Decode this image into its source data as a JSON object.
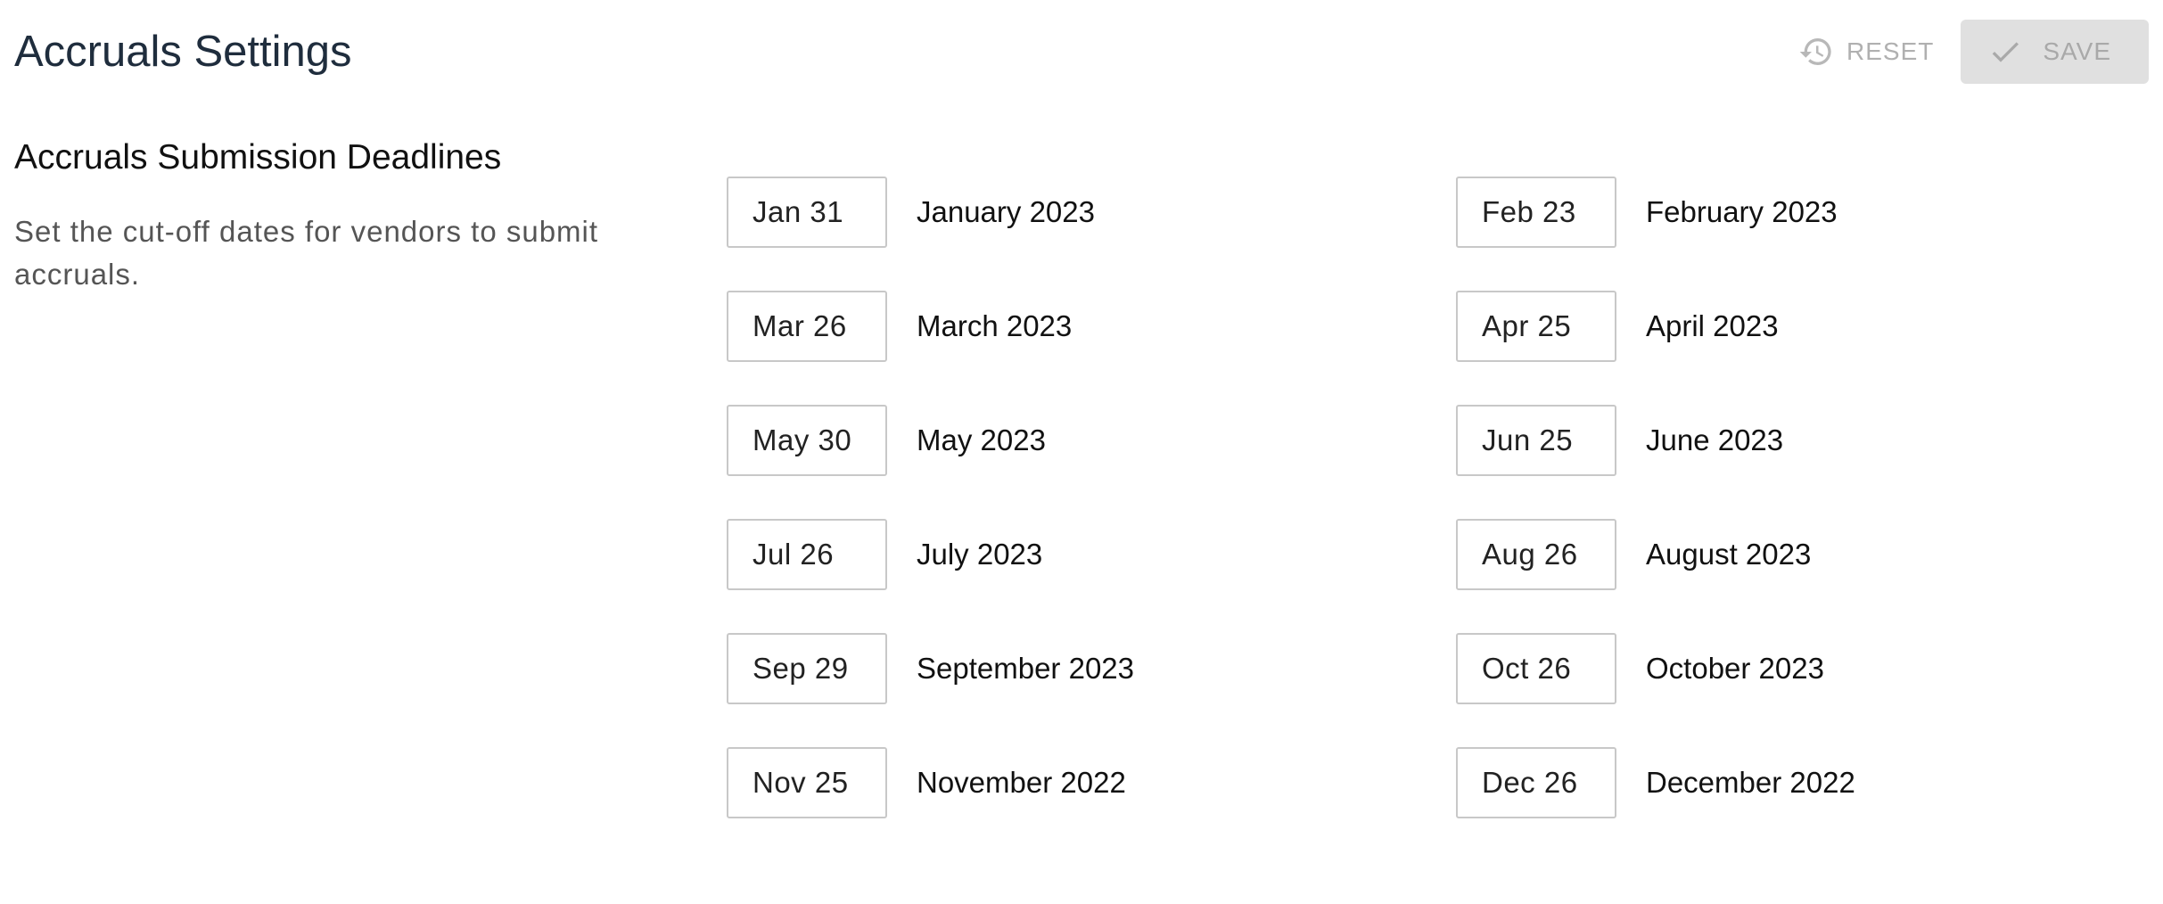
{
  "header": {
    "title": "Accruals Settings",
    "reset_label": "RESET",
    "save_label": "SAVE"
  },
  "section": {
    "title": "Accruals Submission Deadlines",
    "description": "Set the cut-off dates for vendors to submit accruals."
  },
  "deadlines": [
    {
      "date": "Jan 31",
      "month": "January 2023"
    },
    {
      "date": "Feb 23",
      "month": "February 2023"
    },
    {
      "date": "Mar 26",
      "month": "March 2023"
    },
    {
      "date": "Apr 25",
      "month": "April 2023"
    },
    {
      "date": "May 30",
      "month": "May 2023"
    },
    {
      "date": "Jun 25",
      "month": "June 2023"
    },
    {
      "date": "Jul 26",
      "month": "July 2023"
    },
    {
      "date": "Aug 26",
      "month": "August 2023"
    },
    {
      "date": "Sep 29",
      "month": "September 2023"
    },
    {
      "date": "Oct 26",
      "month": "October 2023"
    },
    {
      "date": "Nov 25",
      "month": "November 2022"
    },
    {
      "date": "Dec 26",
      "month": "December 2022"
    }
  ],
  "icons": {
    "reset": "history-icon",
    "save": "check-icon"
  },
  "colors": {
    "title": "#1f2d3d",
    "disabled_text": "#a9a9a9",
    "save_bg": "#e0e0e0",
    "field_border": "#c8c8c8"
  }
}
